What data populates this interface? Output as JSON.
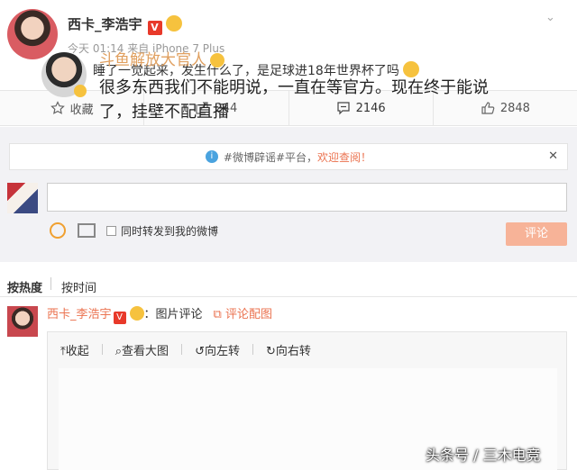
{
  "post": {
    "author": "西卡_李浩宇",
    "vip_badge": "V",
    "emoji_badge": "😮",
    "meta": "今天 01:14 来自 iPhone 7 Plus",
    "text": "。。。睡了一觉起来，发生什么了，是足球进18年世界杯了吗",
    "text_emoji": "😮"
  },
  "actions": {
    "favorite": "收藏",
    "forward": "244",
    "comment": "2146",
    "like": "2848"
  },
  "notice": {
    "text": "#微博辟谣#平台，",
    "link": "欢迎查阅！"
  },
  "composer": {
    "input_value": "",
    "forward_label": "同时转发到我的微博",
    "submit_label": "评论"
  },
  "sort": {
    "hot": "按热度",
    "time": "按时间"
  },
  "comment": {
    "author": "西卡_李浩宇",
    "vip_badge": "V",
    "emoji": "😮",
    "type_label": "：图片评论",
    "link_label": "评论配图"
  },
  "preview": {
    "toolbar": [
      "收起",
      "查看大图",
      "向左转",
      "向右转"
    ],
    "image_name": "斗鱼解放大官人",
    "image_text": "很多东西我们不能明说，一直在等官方。现在终于能说了，挂壁不配直播"
  },
  "watermark": "头条号 / 三木电竞"
}
